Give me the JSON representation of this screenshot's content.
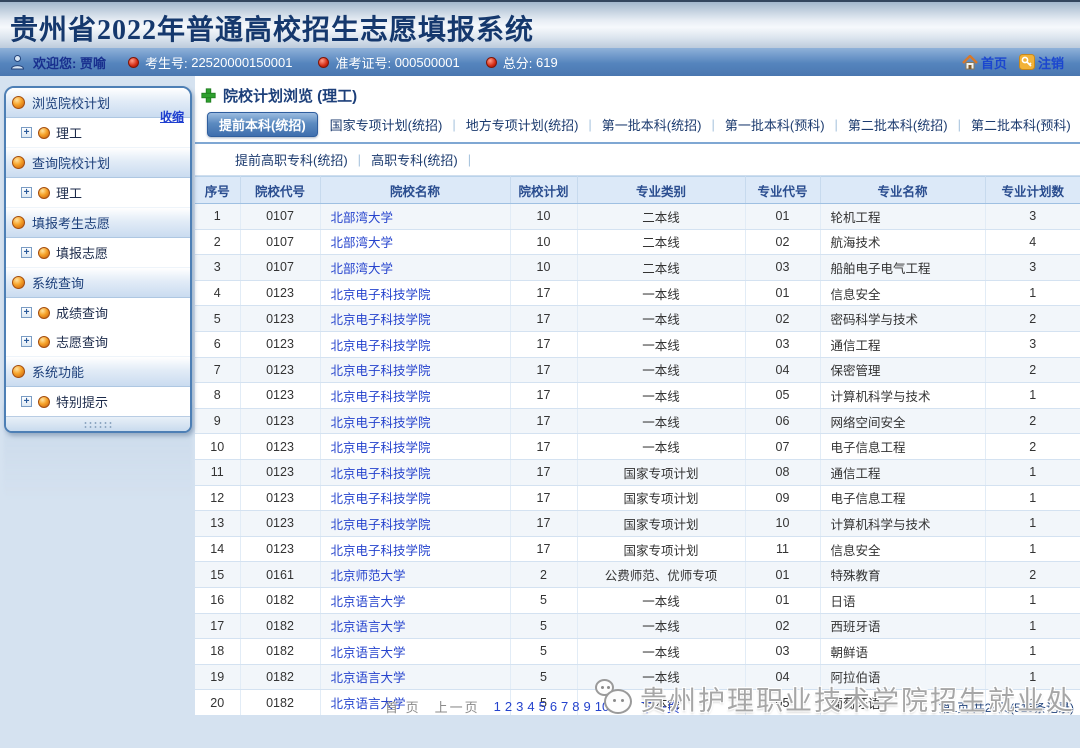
{
  "banner": {
    "title": "贵州省2022年普通高校招生志愿填报系统"
  },
  "user_bar": {
    "welcome_label": "欢迎您:",
    "username": "贾喻",
    "fields": [
      {
        "label": "考生号:",
        "value": "22520000150001"
      },
      {
        "label": "准考证号:",
        "value": "000500001"
      },
      {
        "label": "总分:",
        "value": "619"
      }
    ],
    "home_label": "首页",
    "logout_label": "注销"
  },
  "sidebar": {
    "collapse_label": "收缩",
    "groups": [
      {
        "label": "浏览院校计划",
        "items": [
          {
            "label": "理工"
          }
        ]
      },
      {
        "label": "查询院校计划",
        "items": [
          {
            "label": "理工"
          }
        ]
      },
      {
        "label": "填报考生志愿",
        "items": [
          {
            "label": "填报志愿"
          }
        ]
      },
      {
        "label": "系统查询",
        "items": [
          {
            "label": "成绩查询"
          },
          {
            "label": "志愿查询"
          }
        ]
      },
      {
        "label": "系统功能",
        "items": [
          {
            "label": "特别提示"
          }
        ]
      }
    ]
  },
  "main": {
    "heading": "院校计划浏览 (理工)",
    "active_tab": "提前本科(统招)",
    "tabs_row1": [
      "提前本科(统招)",
      "国家专项计划(统招)",
      "地方专项计划(统招)",
      "第一批本科(统招)",
      "第一批本科(预科)",
      "第二批本科(统招)",
      "第二批本科(预科)"
    ],
    "tabs_row2": [
      "提前高职专科(统招)",
      "高职专科(统招)"
    ],
    "table": {
      "headers": [
        "序号",
        "院校代号",
        "院校名称",
        "院校计划",
        "专业类别",
        "专业代号",
        "专业名称",
        "专业计划数"
      ],
      "rows": [
        [
          "1",
          "0107",
          "北部湾大学",
          "10",
          "二本线",
          "01",
          "轮机工程",
          "3"
        ],
        [
          "2",
          "0107",
          "北部湾大学",
          "10",
          "二本线",
          "02",
          "航海技术",
          "4"
        ],
        [
          "3",
          "0107",
          "北部湾大学",
          "10",
          "二本线",
          "03",
          "船舶电子电气工程",
          "3"
        ],
        [
          "4",
          "0123",
          "北京电子科技学院",
          "17",
          "一本线",
          "01",
          "信息安全",
          "1"
        ],
        [
          "5",
          "0123",
          "北京电子科技学院",
          "17",
          "一本线",
          "02",
          "密码科学与技术",
          "2"
        ],
        [
          "6",
          "0123",
          "北京电子科技学院",
          "17",
          "一本线",
          "03",
          "通信工程",
          "3"
        ],
        [
          "7",
          "0123",
          "北京电子科技学院",
          "17",
          "一本线",
          "04",
          "保密管理",
          "2"
        ],
        [
          "8",
          "0123",
          "北京电子科技学院",
          "17",
          "一本线",
          "05",
          "计算机科学与技术",
          "1"
        ],
        [
          "9",
          "0123",
          "北京电子科技学院",
          "17",
          "一本线",
          "06",
          "网络空间安全",
          "2"
        ],
        [
          "10",
          "0123",
          "北京电子科技学院",
          "17",
          "一本线",
          "07",
          "电子信息工程",
          "2"
        ],
        [
          "11",
          "0123",
          "北京电子科技学院",
          "17",
          "国家专项计划",
          "08",
          "通信工程",
          "1"
        ],
        [
          "12",
          "0123",
          "北京电子科技学院",
          "17",
          "国家专项计划",
          "09",
          "电子信息工程",
          "1"
        ],
        [
          "13",
          "0123",
          "北京电子科技学院",
          "17",
          "国家专项计划",
          "10",
          "计算机科学与技术",
          "1"
        ],
        [
          "14",
          "0123",
          "北京电子科技学院",
          "17",
          "国家专项计划",
          "11",
          "信息安全",
          "1"
        ],
        [
          "15",
          "0161",
          "北京师范大学",
          "2",
          "公费师范、优师专项",
          "01",
          "特殊教育",
          "2"
        ],
        [
          "16",
          "0182",
          "北京语言大学",
          "5",
          "一本线",
          "01",
          "日语",
          "1"
        ],
        [
          "17",
          "0182",
          "北京语言大学",
          "5",
          "一本线",
          "02",
          "西班牙语",
          "1"
        ],
        [
          "18",
          "0182",
          "北京语言大学",
          "5",
          "一本线",
          "03",
          "朝鲜语",
          "1"
        ],
        [
          "19",
          "0182",
          "北京语言大学",
          "5",
          "一本线",
          "04",
          "阿拉伯语",
          "1"
        ],
        [
          "20",
          "0182",
          "北京语言大学",
          "5",
          "一本线",
          "05",
          "葡萄牙语",
          "1"
        ]
      ]
    },
    "pagination": {
      "first_label": "首 页",
      "prev_label": "上一页",
      "pages": [
        "1",
        "2",
        "3",
        "4",
        "5",
        "6",
        "7",
        "8",
        "9",
        "10",
        "11"
      ],
      "next_label": "下一页",
      "info": "第1页/共26页(519条记录)"
    },
    "watermark_text": "贵州护理职业技术学院招生就业处"
  },
  "colors": {
    "banner_title": "#15386d",
    "user_bar": "#5584bd",
    "active_tab": "#3f6fae",
    "link_blue": "#2543cd",
    "table_header_bg": "#dce9f8",
    "row_stripe": "#f2f6fa",
    "watermark_gray": "#a6a6a6",
    "red_dot": "#d42a12",
    "orange_ball": "#f6a229"
  }
}
